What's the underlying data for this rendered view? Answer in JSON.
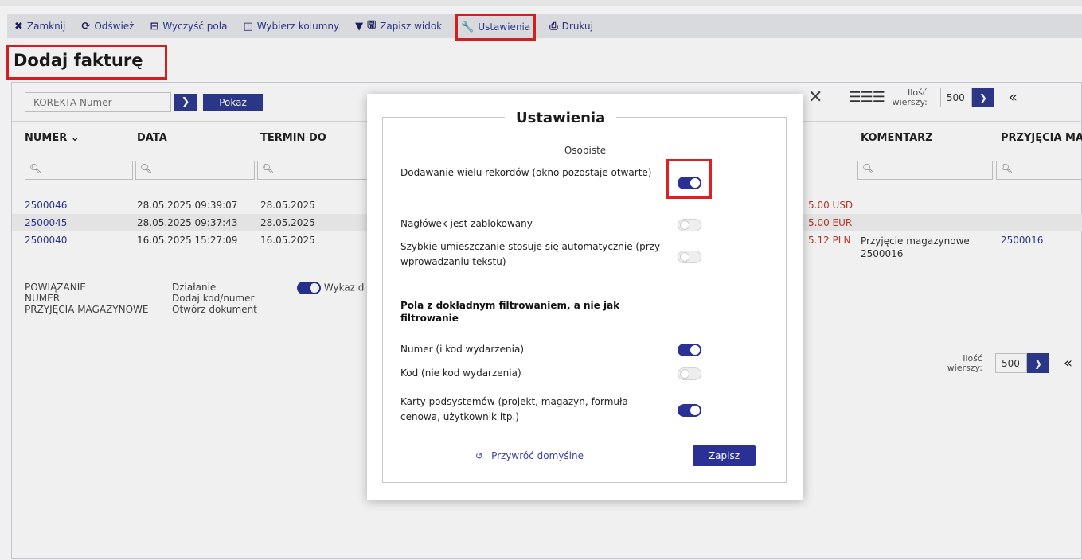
{
  "toolbar": {
    "close": "Zamknij",
    "refresh": "Odśwież",
    "clear": "Wyczyść pola",
    "columns": "Wybierz kolumny",
    "save_view": "Zapisz widok",
    "settings": "Ustawienia",
    "print": "Drukuj"
  },
  "page": {
    "title": "Dodaj fakturę"
  },
  "search": {
    "placeholder": "KOREKTA Numer",
    "show": "Pokaż"
  },
  "rows_control": {
    "label": "Ilość wierszy:",
    "value": "500"
  },
  "columns": [
    "NUMER",
    "DATA",
    "TERMIN DO",
    "KOMENTARZ",
    "PRZYJĘCIA MAG"
  ],
  "rows": [
    {
      "numer": "2500046",
      "data": "28.05.2025 09:39:07",
      "termin": "28.05.2025",
      "amount": "5.00 USD",
      "komentarz": "",
      "przyjecia": ""
    },
    {
      "numer": "2500045",
      "data": "28.05.2025 09:37:43",
      "termin": "28.05.2025",
      "amount": "5.00 EUR",
      "komentarz": "",
      "przyjecia": ""
    },
    {
      "numer": "2500040",
      "data": "16.05.2025 15:27:09",
      "termin": "16.05.2025",
      "amount": "5.12 PLN",
      "komentarz": "Przyjęcie magazynowe 2500016",
      "przyjecia": "2500016"
    }
  ],
  "footer": {
    "col1": [
      "POWIĄZANIE",
      "NUMER",
      "PRZYJĘCIA MAGAZYNOWE"
    ],
    "col2": [
      "Działanie",
      "Dodaj kod/numer",
      "Otwórz dokument"
    ],
    "toggle_label": "Wykaz d"
  },
  "modal": {
    "title": "Ustawienia",
    "section_personal": "Osobiste",
    "options": [
      {
        "label": "Dodawanie wielu rekordów (okno pozostaje otwarte)",
        "on": true
      },
      {
        "label": "Nagłówek jest zablokowany",
        "on": false
      },
      {
        "label": "Szybkie umieszczanie stosuje się automatycznie (przy wprowadzaniu tekstu)",
        "on": false
      }
    ],
    "section_exact": "Pola z dokładnym filtrowaniem, a nie jak filtrowanie",
    "exact_options": [
      {
        "label": "Numer (i kod wydarzenia)",
        "on": true
      },
      {
        "label": "Kod (nie kod wydarzenia)",
        "on": false
      },
      {
        "label": "Karty podsystemów (projekt, magazyn, formuła cenowa, użytkownik itp.)",
        "on": true
      }
    ],
    "restore": "Przywróć domyślne",
    "save": "Zapisz"
  },
  "colors": {
    "accent": "#2a3094",
    "highlight": "#e02020",
    "amount_red": "#c0392b"
  }
}
